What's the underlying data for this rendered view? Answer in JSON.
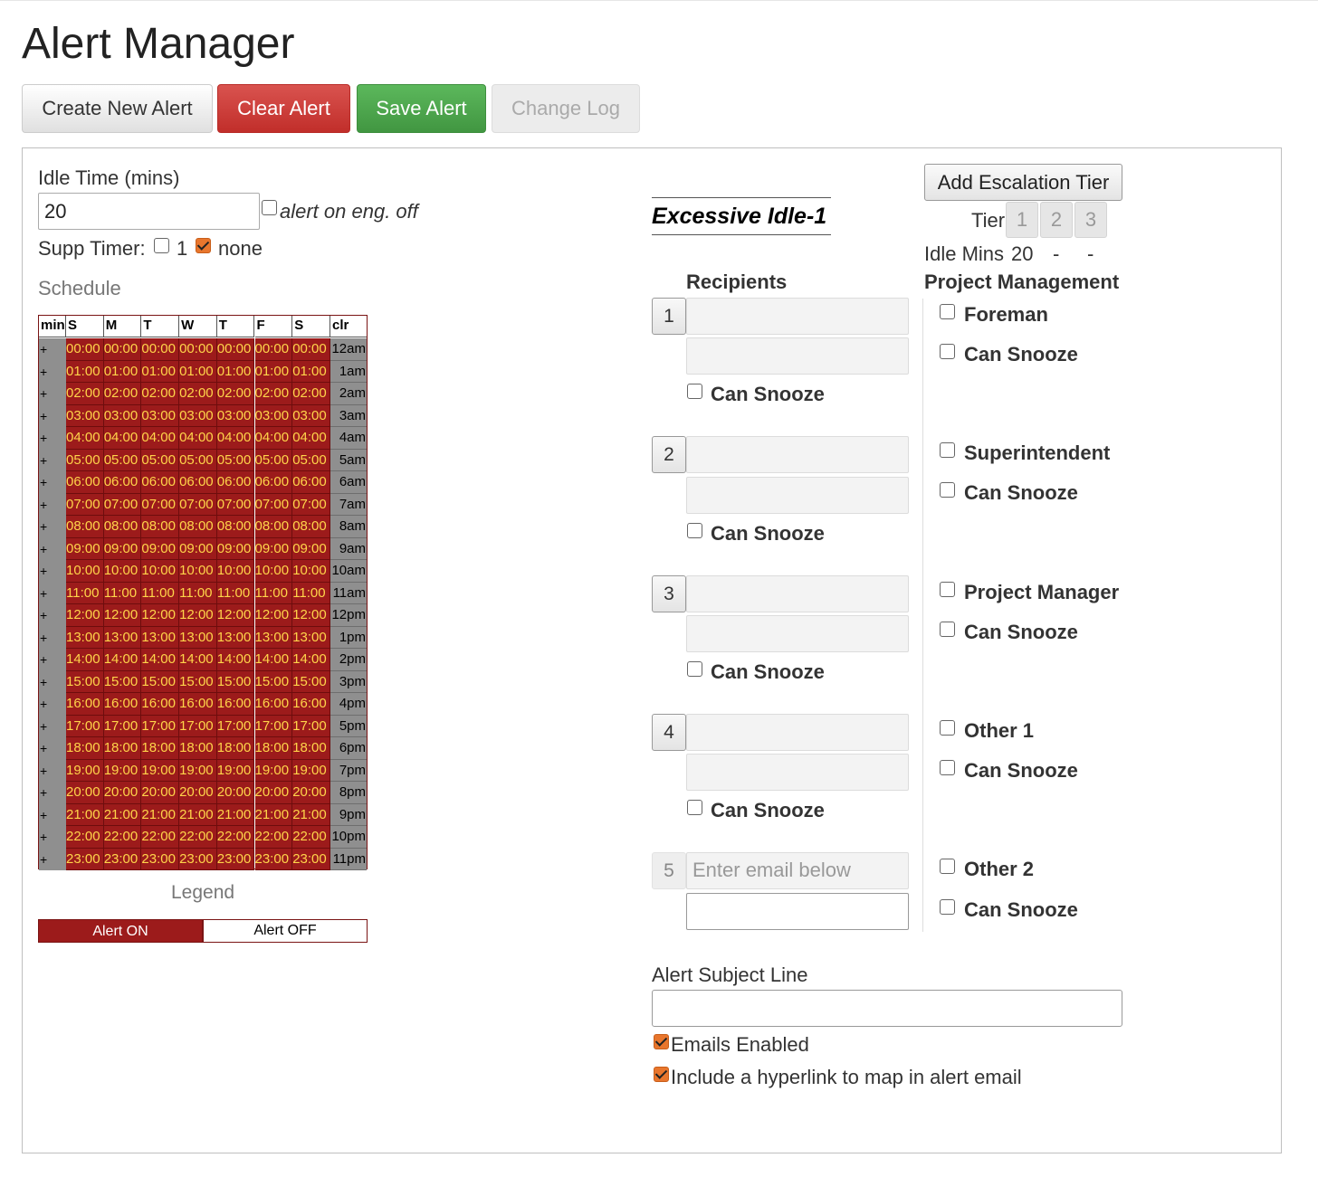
{
  "page": {
    "title": "Alert Manager"
  },
  "toolbar": {
    "create_label": "Create New Alert",
    "clear_label": "Clear Alert",
    "save_label": "Save Alert",
    "changelog_label": "Change Log"
  },
  "idle": {
    "label": "Idle Time (mins)",
    "value": "20",
    "eng_off_label": "alert on eng. off",
    "eng_off_checked": false
  },
  "supp": {
    "label": "Supp Timer:",
    "option1_label": "1",
    "option1_checked": false,
    "option2_label": "none",
    "option2_checked": true
  },
  "schedule": {
    "label": "Schedule",
    "headers": [
      "min",
      "S",
      "M",
      "T",
      "W",
      "T",
      "F",
      "S",
      "clr"
    ],
    "plus": "+",
    "rows": [
      {
        "time": "00:00",
        "clr": "12am"
      },
      {
        "time": "01:00",
        "clr": "1am"
      },
      {
        "time": "02:00",
        "clr": "2am"
      },
      {
        "time": "03:00",
        "clr": "3am"
      },
      {
        "time": "04:00",
        "clr": "4am"
      },
      {
        "time": "05:00",
        "clr": "5am"
      },
      {
        "time": "06:00",
        "clr": "6am"
      },
      {
        "time": "07:00",
        "clr": "7am"
      },
      {
        "time": "08:00",
        "clr": "8am"
      },
      {
        "time": "09:00",
        "clr": "9am"
      },
      {
        "time": "10:00",
        "clr": "10am"
      },
      {
        "time": "11:00",
        "clr": "11am"
      },
      {
        "time": "12:00",
        "clr": "12pm"
      },
      {
        "time": "13:00",
        "clr": "1pm"
      },
      {
        "time": "14:00",
        "clr": "2pm"
      },
      {
        "time": "15:00",
        "clr": "3pm"
      },
      {
        "time": "16:00",
        "clr": "4pm"
      },
      {
        "time": "17:00",
        "clr": "5pm"
      },
      {
        "time": "18:00",
        "clr": "6pm"
      },
      {
        "time": "19:00",
        "clr": "7pm"
      },
      {
        "time": "20:00",
        "clr": "8pm"
      },
      {
        "time": "21:00",
        "clr": "9pm"
      },
      {
        "time": "22:00",
        "clr": "10pm"
      },
      {
        "time": "23:00",
        "clr": "11pm"
      }
    ]
  },
  "legend": {
    "label": "Legend",
    "on_label": "Alert ON",
    "off_label": "Alert OFF"
  },
  "colors": {
    "alert_on": "#9c1b1b",
    "cell_text": "#ffd54a",
    "save": "#419641",
    "clear": "#c12e2a",
    "checked": "#e8762d"
  },
  "alert": {
    "name": "Excessive Idle-1"
  },
  "escalation": {
    "add_label": "Add Escalation Tier",
    "tier_label": "Tier",
    "tiers": [
      "1",
      "2",
      "3"
    ],
    "idle_mins_label": "Idle Mins",
    "idle_mins": [
      "20",
      "-",
      "-"
    ]
  },
  "recipients": {
    "label": "Recipients",
    "can_snooze": "Can Snooze",
    "items": [
      {
        "num": "1"
      },
      {
        "num": "2"
      },
      {
        "num": "3"
      },
      {
        "num": "4"
      },
      {
        "num": "5",
        "placeholder": "Enter email below"
      }
    ]
  },
  "project_management": {
    "label": "Project Management",
    "can_snooze": "Can Snooze",
    "roles": [
      "Foreman",
      "Superintendent",
      "Project Manager",
      "Other 1",
      "Other 2"
    ]
  },
  "subject": {
    "label": "Alert Subject Line",
    "value": ""
  },
  "options": {
    "emails_enabled": "Emails Enabled",
    "hyperlink": "Include a hyperlink to map in alert email"
  }
}
